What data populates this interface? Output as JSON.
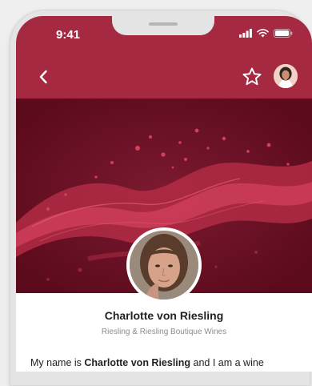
{
  "status_bar": {
    "time": "9:41"
  },
  "header": {
    "back_icon": "chevron-left-icon",
    "favorite_icon": "star-outline-icon"
  },
  "profile": {
    "name": "Charlotte von Riesling",
    "subtitle": "Riesling & Riesling Boutique Wines"
  },
  "bio": {
    "prefix": "My name is ",
    "name": "Charlotte von Riesling",
    "suffix": " and I am a wine"
  },
  "colors": {
    "header": "#a52a41",
    "hero": "#6e0f24",
    "splash": "#c8354e"
  }
}
